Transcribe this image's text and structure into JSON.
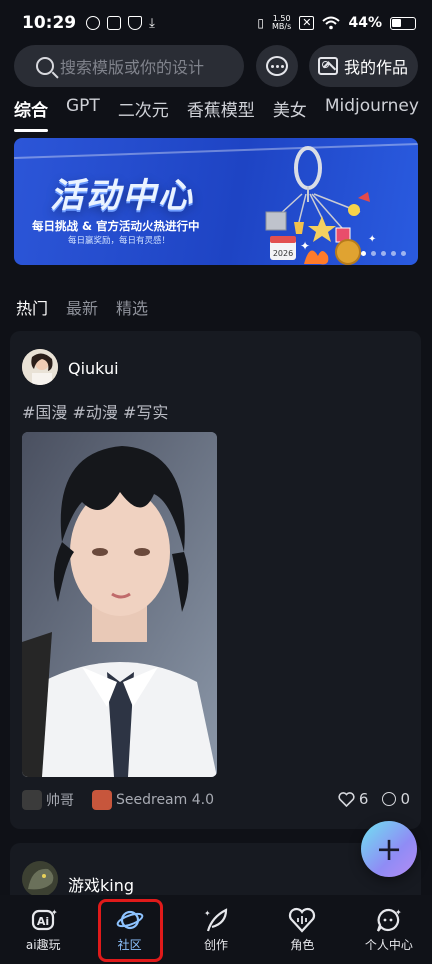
{
  "status_bar": {
    "time": "10:29",
    "net_speed_top": "1.50",
    "net_speed_bottom": "MB/s",
    "battery": "44%"
  },
  "search": {
    "placeholder": "搜索模版或你的设计"
  },
  "header": {
    "my_works_label": "我的作品"
  },
  "categories": [
    "综合",
    "GPT",
    "二次元",
    "香蕉模型",
    "美女",
    "Midjourney"
  ],
  "banner": {
    "title": "活动中心",
    "subtitle": "每日挑战 & 官方活动火热进行中",
    "tagline": "每日赢奖励，每日有灵感！",
    "badge": "2026",
    "page_count": 5,
    "active_page": 1
  },
  "feed_tabs": [
    "热门",
    "最新",
    "精选"
  ],
  "post": {
    "author": "Qiukui",
    "tags": "#国漫 #动漫 #写实",
    "character_name": "帅哥",
    "model_name": "Seedream 4.0",
    "likes": "6",
    "comments": "0"
  },
  "next_post": {
    "author": "游戏king"
  },
  "fab_label": "+",
  "bottom_nav": [
    {
      "label": "ai趣玩",
      "icon": "ai-sparkle-icon"
    },
    {
      "label": "社区",
      "icon": "planet-icon"
    },
    {
      "label": "创作",
      "icon": "feather-icon"
    },
    {
      "label": "角色",
      "icon": "voice-heart-icon"
    },
    {
      "label": "个人中心",
      "icon": "chat-sparkle-icon"
    }
  ],
  "colors": {
    "background": "#0f1117",
    "card": "#171a21",
    "nav_active": "#8ec3ff",
    "highlight_box": "#e01a1a",
    "banner_blue": "#1e44c4"
  }
}
